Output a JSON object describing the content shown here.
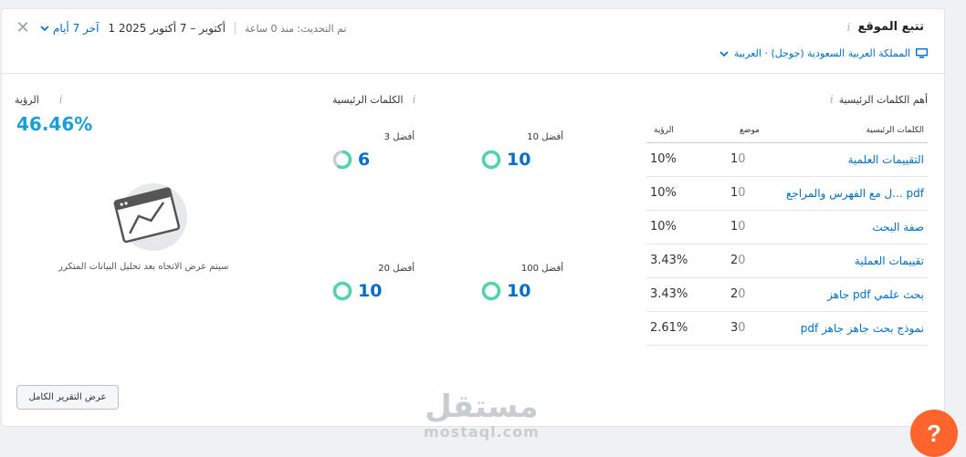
{
  "header": {
    "title": "تتبع الموقع",
    "location": "المملكة العربية السعودية (جوجل) · العربية",
    "period": "آخر 7 أيام",
    "dates": "1 أكتوبر – 7 أكتوبر 2025",
    "updated": "تم التحديث: منذ 0 ساعة",
    "close_glyph": "✕",
    "info_glyph": "i"
  },
  "visibility": {
    "title": "الرؤية",
    "value": "46.46%",
    "trend_note": "سيتم عرض الاتجاه بعد تحليل البيانات المتكرر",
    "report_button": "عرض التقرير الكامل"
  },
  "keywords": {
    "title": "الكلمات الرئيسية",
    "metrics": [
      {
        "label": "أفضل 3",
        "value": "6",
        "fill": 0.6
      },
      {
        "label": "أفضل 10",
        "value": "10",
        "fill": 1.0
      },
      {
        "label": "أفضل 20",
        "value": "10",
        "fill": 1.0
      },
      {
        "label": "أفضل 100",
        "value": "10",
        "fill": 1.0
      }
    ]
  },
  "top_keywords": {
    "title": "أهم الكلمات الرئيسية",
    "columns": {
      "keyword": "الكلمات الرئيسية",
      "position": "موضع",
      "visibility": "الرؤية"
    },
    "rows": [
      {
        "keyword": "التقييمات العلمية",
        "position": "1",
        "change": "0",
        "visibility": "10%"
      },
      {
        "keyword": "pdf ...ل مع الفهرس والمراجع",
        "position": "1",
        "change": "0",
        "visibility": "10%"
      },
      {
        "keyword": "صفة البحث",
        "position": "1",
        "change": "0",
        "visibility": "10%"
      },
      {
        "keyword": "تقييمات العملية",
        "position": "2",
        "change": "0",
        "visibility": "3.43%"
      },
      {
        "keyword": "بحث علمي pdf جاهز",
        "position": "2",
        "change": "0",
        "visibility": "3.43%"
      },
      {
        "keyword": "نموذج بحث جاهز جاهز pdf",
        "position": "3",
        "change": "0",
        "visibility": "2.61%"
      }
    ]
  },
  "watermark": {
    "line1": "مستقل",
    "line2": "mostaql.com"
  },
  "help": {
    "label": "?"
  },
  "colors": {
    "accent": "#006dca",
    "ring_green": "#4fd6a6",
    "ring_gray": "#c8ccd4",
    "help": "#ff642d"
  }
}
